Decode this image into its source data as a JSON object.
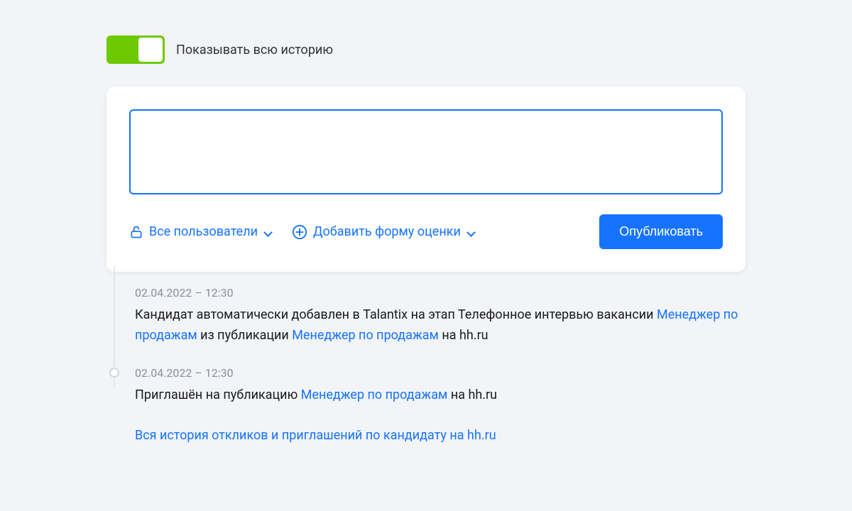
{
  "toggle": {
    "label": "Показывать всю историю",
    "state": true
  },
  "composer": {
    "initial_text": "",
    "visibility": {
      "label": "Все пользователи"
    },
    "add_form": {
      "label": "Добавить форму оценки"
    },
    "publish_button": "Опубликовать"
  },
  "timeline": [
    {
      "date": "02.04.2022 – 12:30",
      "text_prefix": "Кандидат автоматически добавлен в Talantix на этап Телефонное интервью вакансии ",
      "link1": "Менеджер по продажам",
      "text_middle": " из публикации ",
      "link2": "Менеджер по продажам",
      "text_suffix": " на hh.ru"
    },
    {
      "date": "02.04.2022 – 12:30",
      "text_prefix": "Приглашён на публикацию ",
      "link1": "Менеджер по продажам",
      "text_middle": "",
      "link2": "",
      "text_suffix": " на hh.ru"
    }
  ],
  "footer_link": "Вся история откликов и приглашений по кандидату на hh.ru"
}
